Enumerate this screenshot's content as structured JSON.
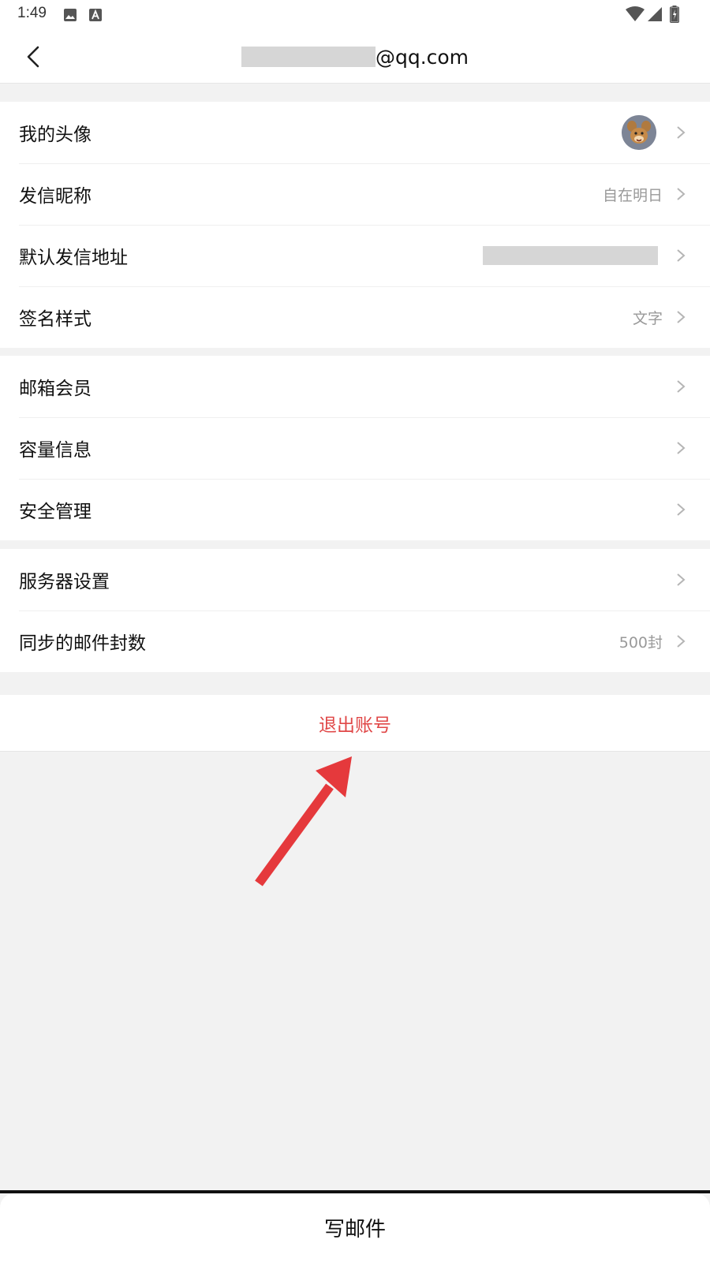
{
  "status_bar": {
    "time": "1:49",
    "left_icons": [
      "image-icon",
      "font-a-icon"
    ],
    "right_icons": [
      "wifi-icon",
      "signal-icon",
      "battery-icon"
    ]
  },
  "nav": {
    "back_icon": "chevron-left-icon",
    "title_suffix": "@qq.com"
  },
  "groups": {
    "profile": [
      {
        "label": "我的头像",
        "value": "",
        "type": "avatar"
      },
      {
        "label": "发信昵称",
        "value": "自在明日"
      },
      {
        "label": "默认发信地址",
        "value": "",
        "type": "redacted"
      },
      {
        "label": "签名样式",
        "value": "文字"
      }
    ],
    "account": [
      {
        "label": "邮箱会员",
        "value": ""
      },
      {
        "label": "容量信息",
        "value": ""
      },
      {
        "label": "安全管理",
        "value": ""
      }
    ],
    "server": [
      {
        "label": "服务器设置",
        "value": ""
      },
      {
        "label": "同步的邮件封数",
        "value": "500封"
      }
    ]
  },
  "logout": {
    "label": "退出账号",
    "color": "#e04848"
  },
  "annotation": {
    "icon": "red-arrow-icon",
    "color": "#e5393c"
  },
  "compose": {
    "label": "写邮件"
  }
}
